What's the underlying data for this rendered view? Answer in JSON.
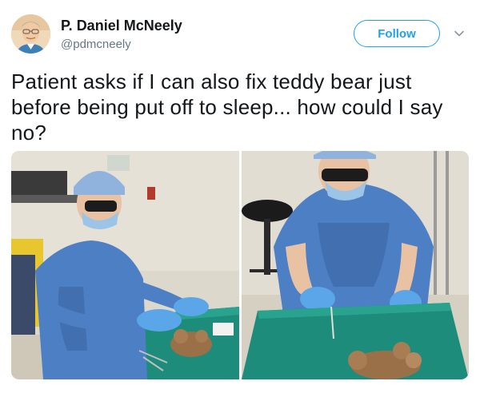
{
  "author": {
    "name": "P. Daniel McNeely",
    "handle": "@pdmcneely"
  },
  "actions": {
    "follow_label": "Follow"
  },
  "tweet": {
    "text": "Patient asks if I can also fix teddy bear just before being put off to sleep... how could I say no?"
  },
  "colors": {
    "accent": "#1da1f2",
    "text": "#14171a",
    "secondary_text": "#657786"
  },
  "icons": {
    "more": "chevron-down-icon"
  }
}
